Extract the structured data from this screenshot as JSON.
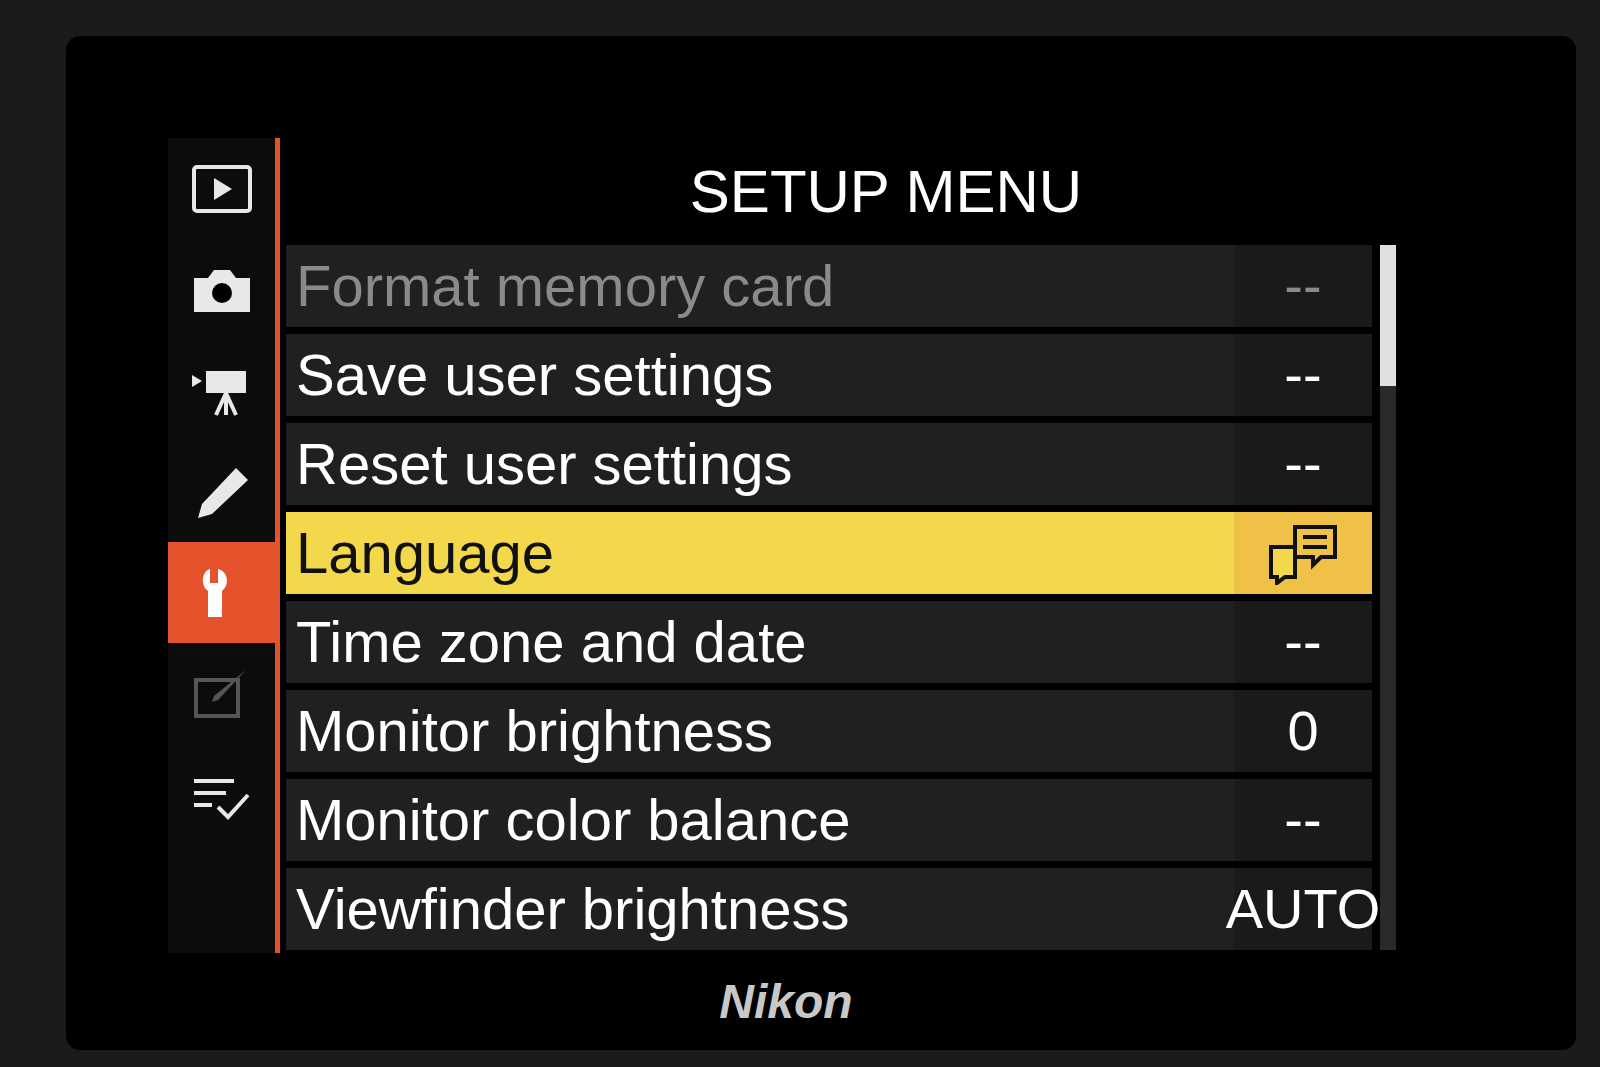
{
  "screen": {
    "title": "SETUP MENU",
    "brand": "Nikon"
  },
  "sidebar": {
    "items": [
      {
        "kind": "playback",
        "selected": false,
        "disabled": false
      },
      {
        "kind": "photo",
        "selected": false,
        "disabled": false
      },
      {
        "kind": "movie",
        "selected": false,
        "disabled": false
      },
      {
        "kind": "custom",
        "selected": false,
        "disabled": false
      },
      {
        "kind": "setup",
        "selected": true,
        "disabled": false
      },
      {
        "kind": "retouch",
        "selected": false,
        "disabled": true
      },
      {
        "kind": "mymenu",
        "selected": false,
        "disabled": false
      }
    ]
  },
  "menu": {
    "rows": [
      {
        "label": "Format memory card",
        "value": "--",
        "kind": "text",
        "selected": false,
        "disabled": true
      },
      {
        "label": "Save user settings",
        "value": "--",
        "kind": "text",
        "selected": false,
        "disabled": false
      },
      {
        "label": "Reset user settings",
        "value": "--",
        "kind": "text",
        "selected": false,
        "disabled": false
      },
      {
        "label": "Language",
        "value": "",
        "kind": "icon",
        "selected": true,
        "disabled": false
      },
      {
        "label": "Time zone and date",
        "value": "--",
        "kind": "text",
        "selected": false,
        "disabled": false
      },
      {
        "label": "Monitor brightness",
        "value": "0",
        "kind": "text",
        "selected": false,
        "disabled": false
      },
      {
        "label": "Monitor color balance",
        "value": "--",
        "kind": "text",
        "selected": false,
        "disabled": false
      },
      {
        "label": "Viewfinder brightness",
        "value": "AUTO",
        "kind": "text",
        "selected": false,
        "disabled": false
      }
    ]
  },
  "scrollbar": {
    "level": 0.2,
    "position": 0
  }
}
